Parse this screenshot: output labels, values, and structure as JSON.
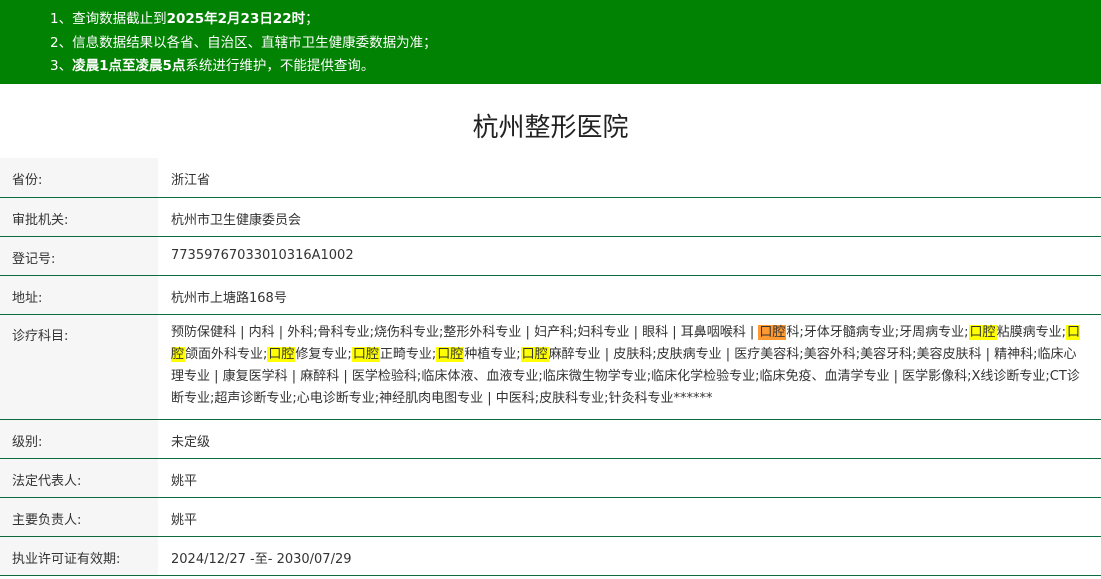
{
  "notice": {
    "line1_prefix": "1、查询数据截止到",
    "line1_bold": "2025年2月23日22时",
    "line1_suffix": "；",
    "line2": "2、信息数据结果以各省、自治区、直辖市卫生健康委数据为准；",
    "line3_prefix": "3、",
    "line3_bold": "凌晨1点至凌晨5点",
    "line3_suffix": "系统进行维护，不能提供查询。"
  },
  "hospital": {
    "name": "杭州整形医院"
  },
  "rows": {
    "province": {
      "label": "省份:",
      "value": "浙江省"
    },
    "authority": {
      "label": "审批机关:",
      "value": "杭州市卫生健康委员会"
    },
    "reg_no": {
      "label": "登记号:",
      "value": "77359767033010316A1002"
    },
    "address": {
      "label": "地址:",
      "value": "杭州市上塘路168号"
    },
    "departments": {
      "label": "诊疗科目:",
      "segments": [
        "预防保健科 | 内科 | 外科;骨科专业;烧伤科专业;整形外科专业 | 妇产科;妇科专业 | 眼科 | 耳鼻咽喉科 | ",
        "口腔",
        "科;牙体牙髓病专业;牙周病专业;",
        "口腔",
        "粘膜病专业;",
        "口腔",
        "颌面外科专业;",
        "口腔",
        "修复专业;",
        "口腔",
        "正畸专业;",
        "口腔",
        "种植专业;",
        "口腔",
        "麻醉专业 | 皮肤科;皮肤病专业 | 医疗美容科;美容外科;美容牙科;美容皮肤科 | 精神科;临床心理专业 | 康复医学科 | 麻醉科 | 医学检验科;临床体液、血液专业;临床微生物学专业;临床化学检验专业;临床免疫、血清学专业 | 医学影像科;X线诊断专业;CT诊断专业;超声诊断专业;心电诊断专业;神经肌肉电图专业 | 中医科;皮肤科专业;针灸科专业******"
      ]
    },
    "level": {
      "label": "级别:",
      "value": "未定级"
    },
    "legal_rep": {
      "label": "法定代表人:",
      "value": "姚平"
    },
    "principal": {
      "label": "主要负责人:",
      "value": "姚平"
    },
    "license": {
      "label": "执业许可证有效期:",
      "value": "2024/12/27 -至- 2030/07/29"
    }
  },
  "colors": {
    "notice_bg": "#028202",
    "highlight": "#ffff00",
    "highlight_active": "#ff9a32",
    "row_border": "#0c6b3c"
  }
}
